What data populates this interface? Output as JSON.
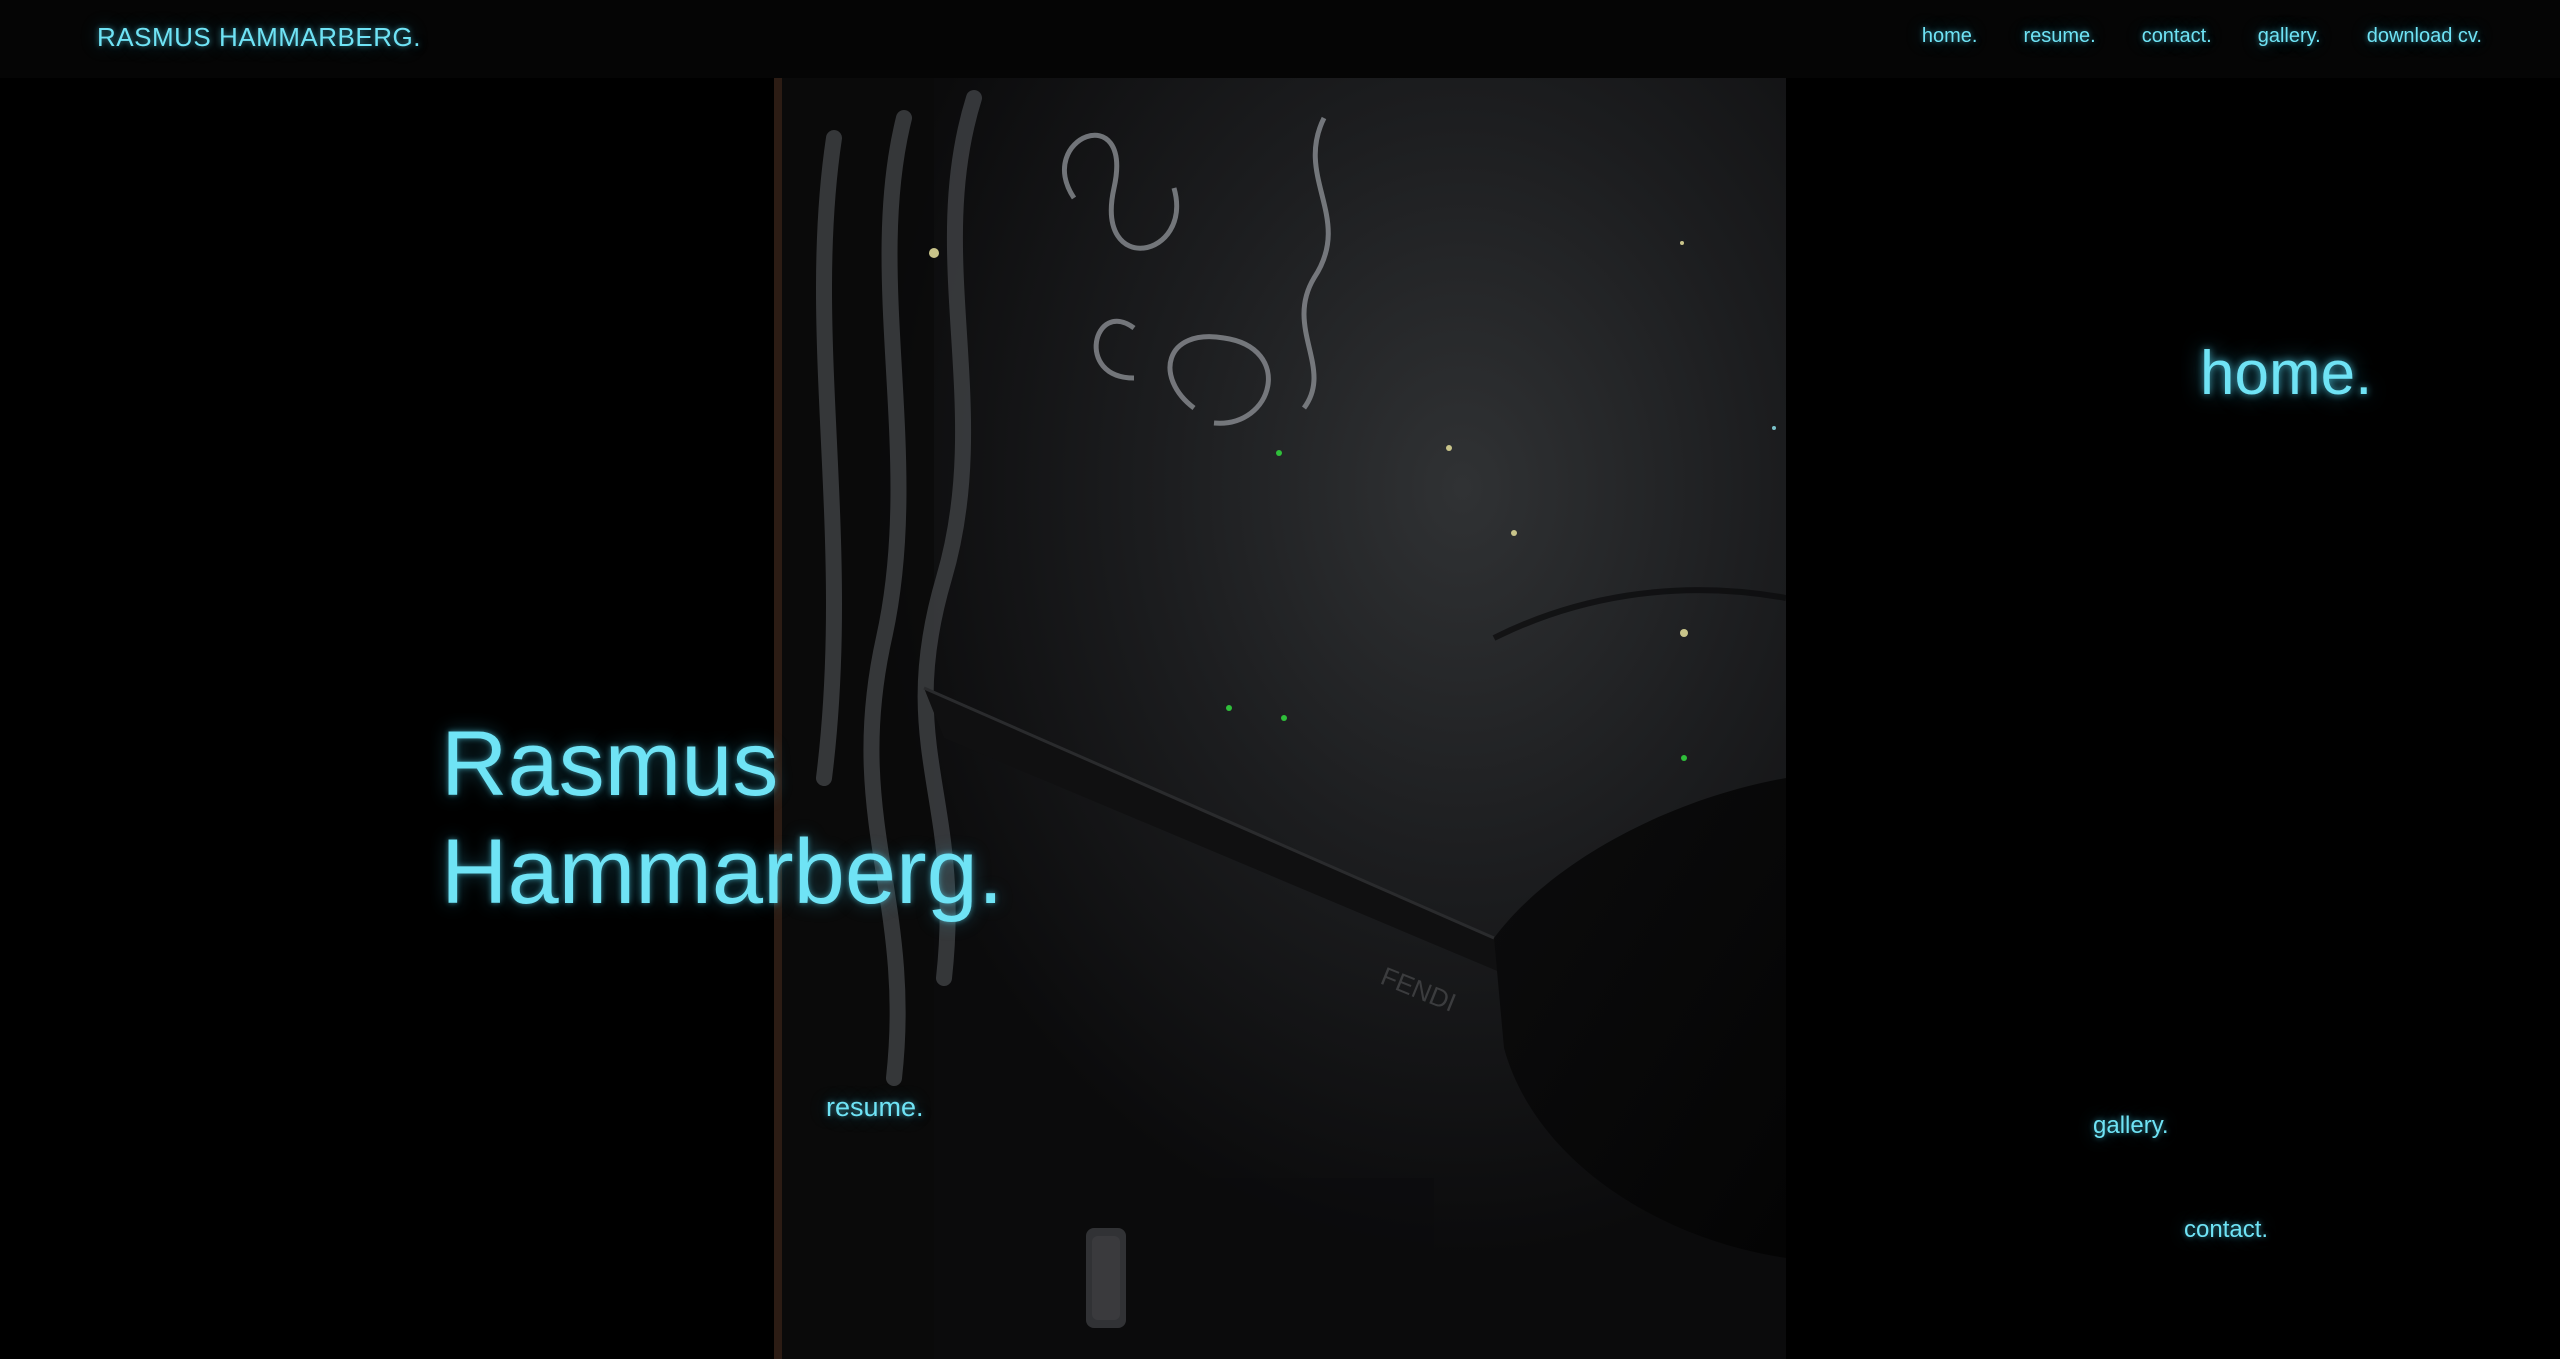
{
  "header": {
    "brand": "RASMUS HAMMARBERG.",
    "nav": [
      {
        "label": "home."
      },
      {
        "label": "resume."
      },
      {
        "label": "contact."
      },
      {
        "label": "gallery."
      },
      {
        "label": "download cv."
      }
    ]
  },
  "hero": {
    "title_line1": "Rasmus",
    "title_line2": "Hammarberg.",
    "photo_icon": "portrait-photo"
  },
  "floating_links": {
    "home": "home.",
    "resume": "resume.",
    "gallery": "gallery.",
    "contact": "contact."
  },
  "colors": {
    "accent": "#6fe3f5",
    "background": "#000000"
  }
}
